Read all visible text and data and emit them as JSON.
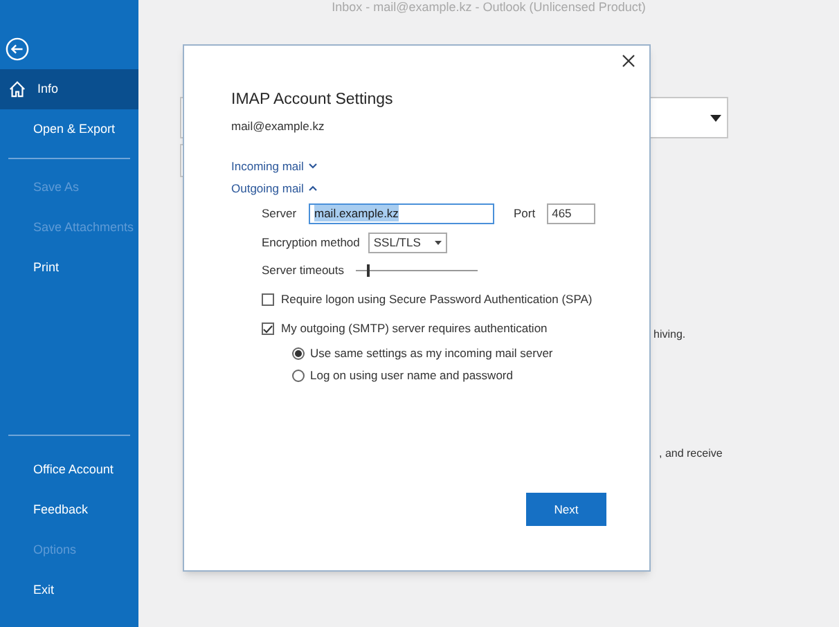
{
  "window": {
    "title": "Inbox - mail@example.kz - Outlook (Unlicensed Product)"
  },
  "sidebar": {
    "items": [
      {
        "label": "Info",
        "selected": true,
        "disabled": false
      },
      {
        "label": "Open & Export",
        "selected": false,
        "disabled": false
      },
      {
        "label": "Save As",
        "selected": false,
        "disabled": true
      },
      {
        "label": "Save Attachments",
        "selected": false,
        "disabled": true
      },
      {
        "label": "Print",
        "selected": false,
        "disabled": false
      }
    ],
    "bottom_items": [
      {
        "label": "Office Account",
        "selected": false,
        "disabled": false
      },
      {
        "label": "Feedback",
        "selected": false,
        "disabled": false
      },
      {
        "label": "Options",
        "selected": false,
        "disabled": true
      },
      {
        "label": "Exit",
        "selected": false,
        "disabled": false
      }
    ]
  },
  "background": {
    "fragments": [
      "hiving.",
      ", and receive"
    ]
  },
  "dialog": {
    "title": "IMAP Account Settings",
    "email": "mail@example.kz",
    "sections": [
      {
        "label": "Incoming mail",
        "expanded": false
      },
      {
        "label": "Outgoing mail",
        "expanded": true
      }
    ],
    "server": {
      "label": "Server",
      "value": "mail.example.kz"
    },
    "port": {
      "label": "Port",
      "value": "465"
    },
    "encryption": {
      "label": "Encryption method",
      "value": "SSL/TLS"
    },
    "timeouts": {
      "label": "Server timeouts",
      "level": 0.1
    },
    "checkboxes": [
      {
        "label": "Require logon using Secure Password Authentication (SPA)",
        "checked": false
      },
      {
        "label": "My outgoing (SMTP) server requires authentication",
        "checked": true
      }
    ],
    "radios": [
      {
        "label": "Use same settings as my incoming mail server",
        "selected": true
      },
      {
        "label": "Log on using user name and password",
        "selected": false
      }
    ],
    "next_button": "Next"
  }
}
